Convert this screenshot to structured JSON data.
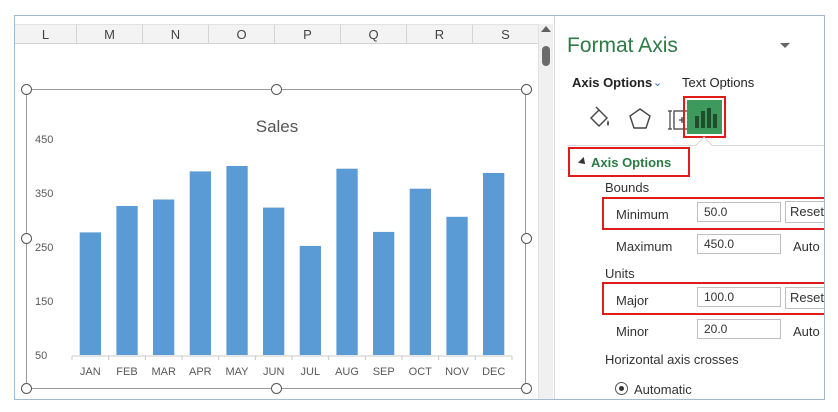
{
  "sheet": {
    "columns": [
      "L",
      "M",
      "N",
      "O",
      "P",
      "Q",
      "R",
      "S"
    ]
  },
  "chart_data": {
    "type": "bar",
    "title": "Sales",
    "categories": [
      "JAN",
      "FEB",
      "MAR",
      "APR",
      "MAY",
      "JUN",
      "JUL",
      "AUG",
      "SEP",
      "OCT",
      "NOV",
      "DEC"
    ],
    "values": [
      277,
      326,
      338,
      390,
      400,
      323,
      252,
      395,
      278,
      358,
      306,
      387
    ],
    "ylim": [
      50,
      450
    ],
    "yticks": [
      50,
      150,
      250,
      350,
      450
    ],
    "bar_color": "#5b9bd5",
    "grid": false
  },
  "pane": {
    "title": "Format Axis",
    "tab_axis_options": "Axis Options",
    "tab_text_options": "Text Options",
    "icons": [
      "fill-line-icon",
      "effects-icon",
      "size-properties-icon",
      "axis-options-icon"
    ],
    "section_title": "Axis Options",
    "bounds_label": "Bounds",
    "minimum_label": "Minimum",
    "minimum_value": "50.0",
    "minimum_action": "Reset",
    "maximum_label": "Maximum",
    "maximum_value": "450.0",
    "maximum_action": "Auto",
    "units_label": "Units",
    "major_label": "Major",
    "major_value": "100.0",
    "major_action": "Reset",
    "minor_label": "Minor",
    "minor_value": "20.0",
    "minor_action": "Auto",
    "crosses_label": "Horizontal axis crosses",
    "automatic_label": "Automatic",
    "accent_color": "#2d7a45",
    "highlight_color": "#e11a1a"
  }
}
